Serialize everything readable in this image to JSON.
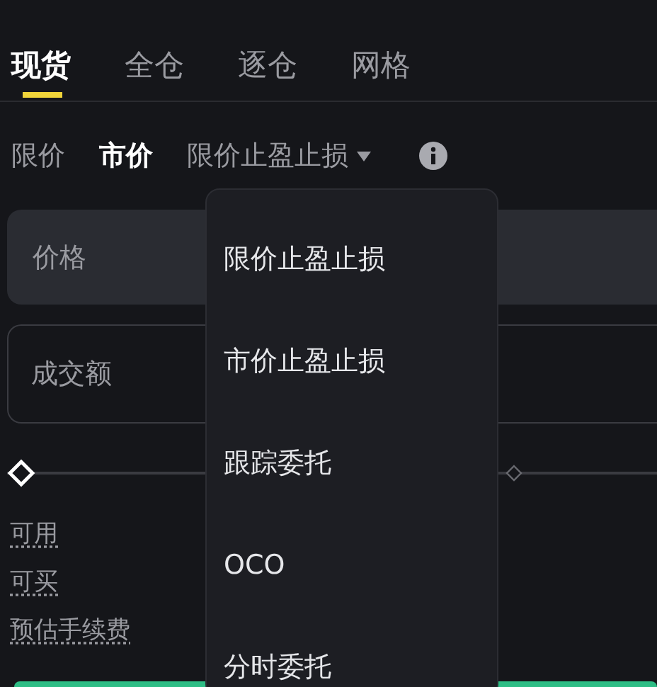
{
  "tabs": [
    {
      "label": "现货",
      "selected": true
    },
    {
      "label": "全仓",
      "selected": false
    },
    {
      "label": "逐仓",
      "selected": false
    },
    {
      "label": "网格",
      "selected": false
    }
  ],
  "order_types": [
    {
      "label": "限价",
      "selected": false,
      "kind": "plain"
    },
    {
      "label": "市价",
      "selected": true,
      "kind": "plain"
    },
    {
      "label": "限价止盈止损",
      "selected": false,
      "kind": "dropdown"
    }
  ],
  "price_field": {
    "placeholder": "价格"
  },
  "amount_field": {
    "placeholder": "成交额"
  },
  "slider": {
    "level": 0
  },
  "info_labels": [
    "可用",
    "可买",
    "预估手续费"
  ],
  "dropdown_menu": {
    "items": [
      "限价止盈止损",
      "市价止盈止损",
      "跟踪委托",
      "OCO",
      "分时委托"
    ]
  }
}
